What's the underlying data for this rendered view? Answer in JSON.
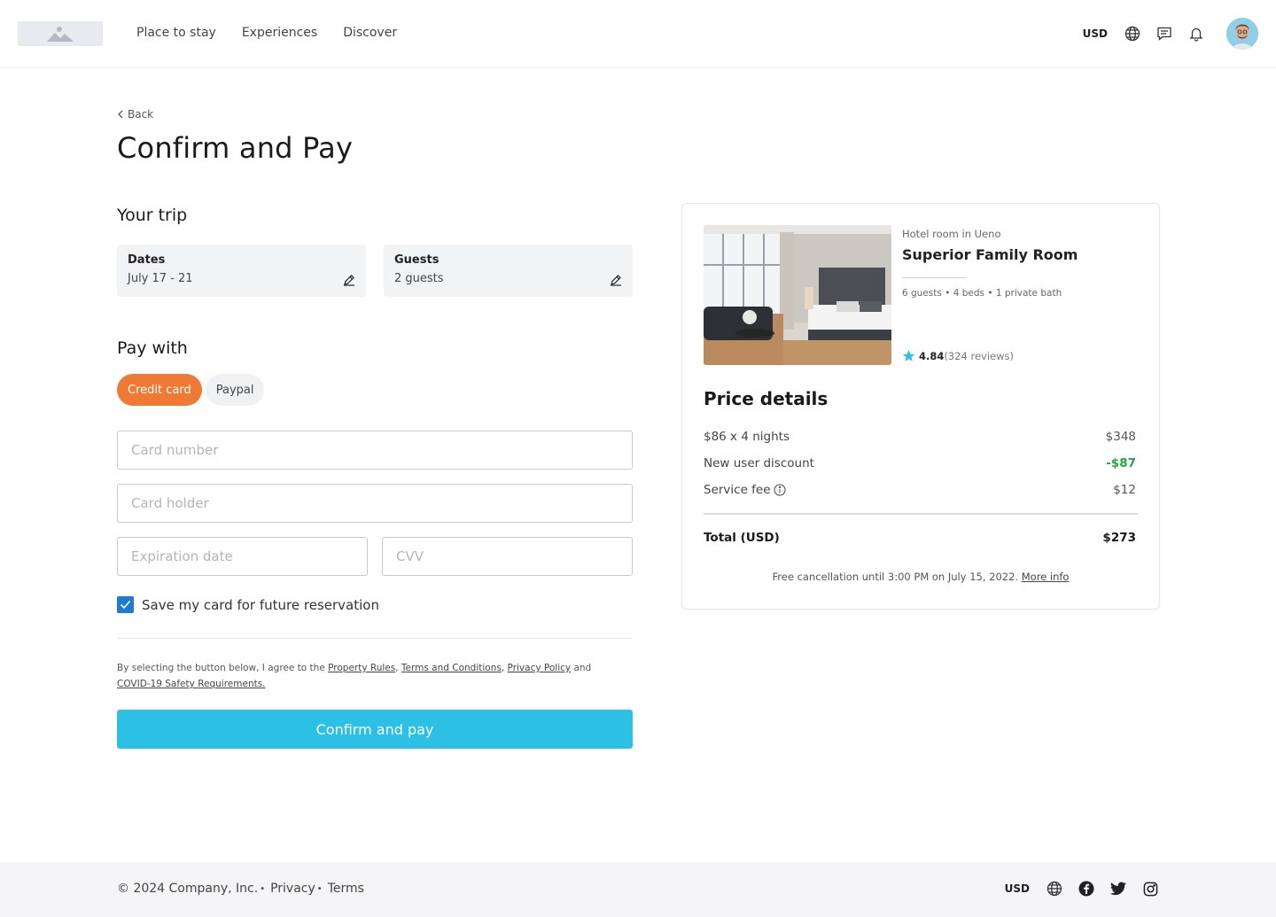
{
  "header": {
    "nav": [
      "Place to stay",
      "Experiences",
      "Discover"
    ],
    "currency": "USD"
  },
  "main": {
    "back_label": "Back",
    "title": "Confirm and Pay",
    "trip": {
      "heading": "Your trip",
      "dates_label": "Dates",
      "dates_value": "July 17 - 21",
      "guests_label": "Guests",
      "guests_value": "2 guests"
    },
    "pay": {
      "heading": "Pay with",
      "tabs": [
        "Credit card",
        "Paypal"
      ],
      "active_tab": "Credit card",
      "card_number_placeholder": "Card number",
      "card_holder_placeholder": "Card holder",
      "expiration_placeholder": "Expiration date",
      "cvv_placeholder": "CVV",
      "save_card_label": "Save my card for future reservation",
      "save_card_checked": true
    },
    "legal": {
      "prefix": "By selecting the button below, I agree to the ",
      "property_rules": "Property Rules",
      "terms": "Terms and Conditions",
      "privacy": "Privacy Policy",
      "and": " and ",
      "covid": "COVID-19 Safety Requirements."
    },
    "confirm_label": "Confirm and pay"
  },
  "summary": {
    "room_type": "Hotel room in Ueno",
    "room_name": "Superior Family Room",
    "features": "6 guests • 4 beds • 1 private bath",
    "rating": "4.84",
    "reviews": "(324 reviews)",
    "price_title": "Price details",
    "rows": [
      {
        "label": "$86 x 4 nights",
        "amount": "$348"
      },
      {
        "label": "New user discount",
        "amount": "-$87"
      },
      {
        "label": "Service fee",
        "amount": "$12"
      }
    ],
    "total_label": "Total (USD)",
    "total_amount": "$273",
    "cancel_text": "Free cancellation until 3:00 PM on July 15, 2022. ",
    "more_info": "More info"
  },
  "footer": {
    "copyright": "© 2024 Company, Inc.",
    "privacy": "Privacy",
    "terms": "Terms",
    "currency": "USD"
  },
  "colors": {
    "accent_orange": "#ef7a35",
    "primary_blue": "#2bc0e4",
    "discount_green": "#1fa84a",
    "checkbox_blue": "#1e7bd1",
    "star": "#2bc0e4"
  },
  "icons": [
    "logo-image-icon",
    "globe-icon",
    "message-icon",
    "bell-icon",
    "chevron-left-icon",
    "pencil-icon",
    "check-icon",
    "star-icon",
    "info-icon",
    "facebook-icon",
    "twitter-icon",
    "instagram-icon"
  ]
}
